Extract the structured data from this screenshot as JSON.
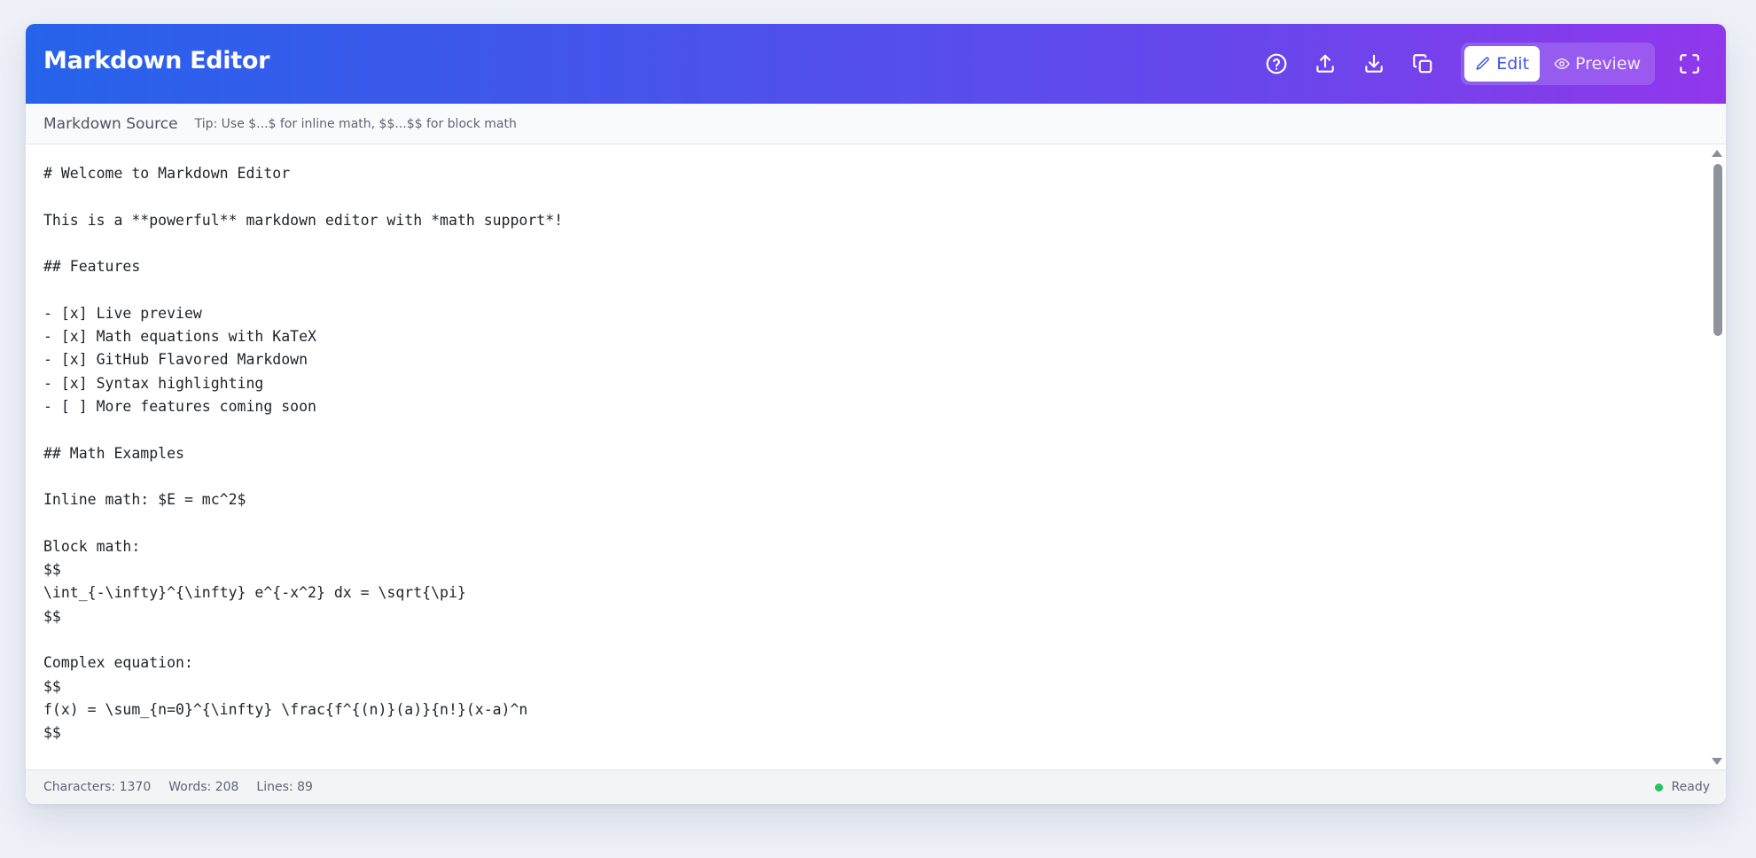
{
  "header": {
    "title": "Markdown Editor",
    "gradient_start": "#2663eb",
    "gradient_end": "#9137ec",
    "toolbar": {
      "icons": [
        "help-circle-icon",
        "upload-icon",
        "download-icon",
        "copy-icon"
      ],
      "edit_label": "Edit",
      "preview_label": "Preview",
      "active_mode": "Edit",
      "fullscreen_icon": "maximize-icon"
    }
  },
  "subheader": {
    "title": "Markdown Source",
    "tip": "Tip: Use $...$ for inline math, $$...$$ for block math"
  },
  "editor": {
    "lines": [
      "# Welcome to Markdown Editor",
      "",
      "This is a **powerful** markdown editor with *math support*!",
      "",
      "## Features",
      "",
      "- [x] Live preview",
      "- [x] Math equations with KaTeX",
      "- [x] GitHub Flavored Markdown",
      "- [x] Syntax highlighting",
      "- [ ] More features coming soon",
      "",
      "## Math Examples",
      "",
      "Inline math: $E = mc^2$",
      "",
      "Block math:",
      "$$",
      "\\int_{-\\infty}^{\\infty} e^{-x^2} dx = \\sqrt{\\pi}",
      "$$",
      "",
      "Complex equation:",
      "$$",
      "f(x) = \\sum_{n=0}^{\\infty} \\frac{f^{(n)}(a)}{n!}(x-a)^n",
      "$$"
    ]
  },
  "statusbar": {
    "characters_label": "Characters: ",
    "characters_value": "1370",
    "words_label": "Words: ",
    "words_value": "208",
    "lines_label": "Lines: ",
    "lines_value": "89",
    "status_text": "Ready",
    "status_color": "#22c55e"
  }
}
